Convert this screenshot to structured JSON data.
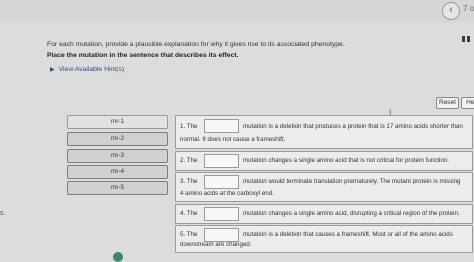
{
  "nav": {
    "back_glyph": "‹",
    "page_indicator": "7 o"
  },
  "edge_text": "s.",
  "instructions": {
    "text": "For each mutation, provide a plausible explanation for why it gives rise to its associated phenotype.",
    "bold": "Place the mutation in the sentence that describes its effect."
  },
  "hint": {
    "arrow": "▶",
    "label": "View Available Hint(s)"
  },
  "buttons": {
    "reset": "Reset",
    "help": "Hel"
  },
  "cursor_glyph": "I",
  "tiles": [
    "mr-1",
    "mr-2",
    "mr-3",
    "mr-4",
    "mr-5"
  ],
  "sentences": [
    {
      "prefix": "1. The",
      "after": "mutation is a deletion that produces a protein that is 17 amino acids shorter than",
      "line2": "normal. It does not cause a frameshift."
    },
    {
      "prefix": "2. The",
      "after": "mutation changes a single amino acid that is not critical for protein function.",
      "line2": ""
    },
    {
      "prefix": "3. The",
      "after": "mutation would terminate translation prematurely. The mutant protein is missing",
      "line2": "4 amino acids at the carboxyl end."
    },
    {
      "prefix": "4. The",
      "after": "mutation changes a single amino acid, disrupting a critical region of the protein.",
      "line2": ""
    },
    {
      "prefix": "5. The",
      "after": "mutation is a deletion that causes a frameshift. Most or all of the amino acids",
      "line2": "downstream are changed."
    }
  ]
}
